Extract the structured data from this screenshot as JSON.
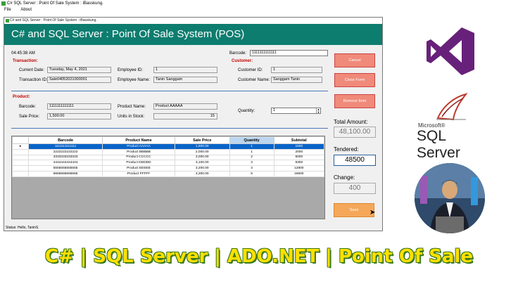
{
  "outer_window": {
    "title": "C# SQL Server : Point Of Sale System : iBasskung.",
    "menu": [
      "File",
      "About"
    ]
  },
  "form": {
    "title": "C# and SQL Server : Point Of Sale System : iBasskung.",
    "banner": "C# and SQL Server : Point Of Sale System (POS)",
    "time": "04:45:38 AM",
    "barcode_label": "Barcode:",
    "barcode_value": "1111111111111",
    "transaction": {
      "group": "Transaction:",
      "current_date_label": "Current Date:",
      "current_date": "Tuesday, May 4, 2021",
      "transaction_id_label": "Transaction ID:",
      "transaction_id": "Sale04052021000001",
      "employee_id_label": "Employee ID:",
      "employee_id": "1",
      "employee_name_label": "Employee Name:",
      "employee_name": "Tanin Sanggam"
    },
    "customer": {
      "group": "Customer:",
      "customer_id_label": "Customer ID:",
      "customer_id": "1",
      "customer_name_label": "Customer Name:",
      "customer_name": "Sanggam Tanin"
    },
    "product": {
      "group": "Product:",
      "barcode_label": "Barcode:",
      "barcode": "1111111111111",
      "sale_price_label": "Sale Price:",
      "sale_price": "1,500.00",
      "product_name_label": "Product Name:",
      "product_name": "Product AAAAA",
      "units_label": "Units in Stock:",
      "units": "15",
      "quantity_label": "Quantity:",
      "quantity": "1"
    },
    "buttons": {
      "cancel": "Cancel",
      "close": "Close Form",
      "remove": "Remove Item",
      "save": "Save"
    },
    "totals": {
      "total_label": "Total Amount:",
      "total": "48,100.00",
      "tendered_label": "Tendered:",
      "tendered": "48500",
      "change_label": "Change:",
      "change": "400"
    },
    "grid": {
      "columns": [
        "Barcode",
        "Product Name",
        "Sale Price",
        "Quantity",
        "Subtotal"
      ],
      "rows": [
        [
          "1111111111111",
          "Product AAAAA",
          "1,500.00",
          "1",
          "1500"
        ],
        [
          "2222222222222",
          "Product BBBBB",
          "2,000.00",
          "1",
          "2000"
        ],
        [
          "3333333333333",
          "Product CCCCC",
          "3,000.00",
          "2",
          "6000"
        ],
        [
          "4444444444444",
          "Product DDDDD",
          "3,100.00",
          "3",
          "9300"
        ],
        [
          "5555555555555",
          "Product EEEEE",
          "3,200.00",
          "4",
          "12800"
        ],
        [
          "6666666666666",
          "Product FFFFF",
          "3,300.00",
          "5",
          "16500"
        ]
      ]
    },
    "status": "Status: Hello, TaninS"
  },
  "logos": {
    "sql_vendor": "Microsoft®",
    "sql_product": "SQL Server"
  },
  "headline": "C# | SQL Server | ADO.NET | Point Of Sale",
  "colors": {
    "banner": "#0d7d6f",
    "button": "#f08a7a",
    "save_button": "#f5a85a",
    "selected_row": "#0a64c8",
    "headline": "#ffe000"
  }
}
